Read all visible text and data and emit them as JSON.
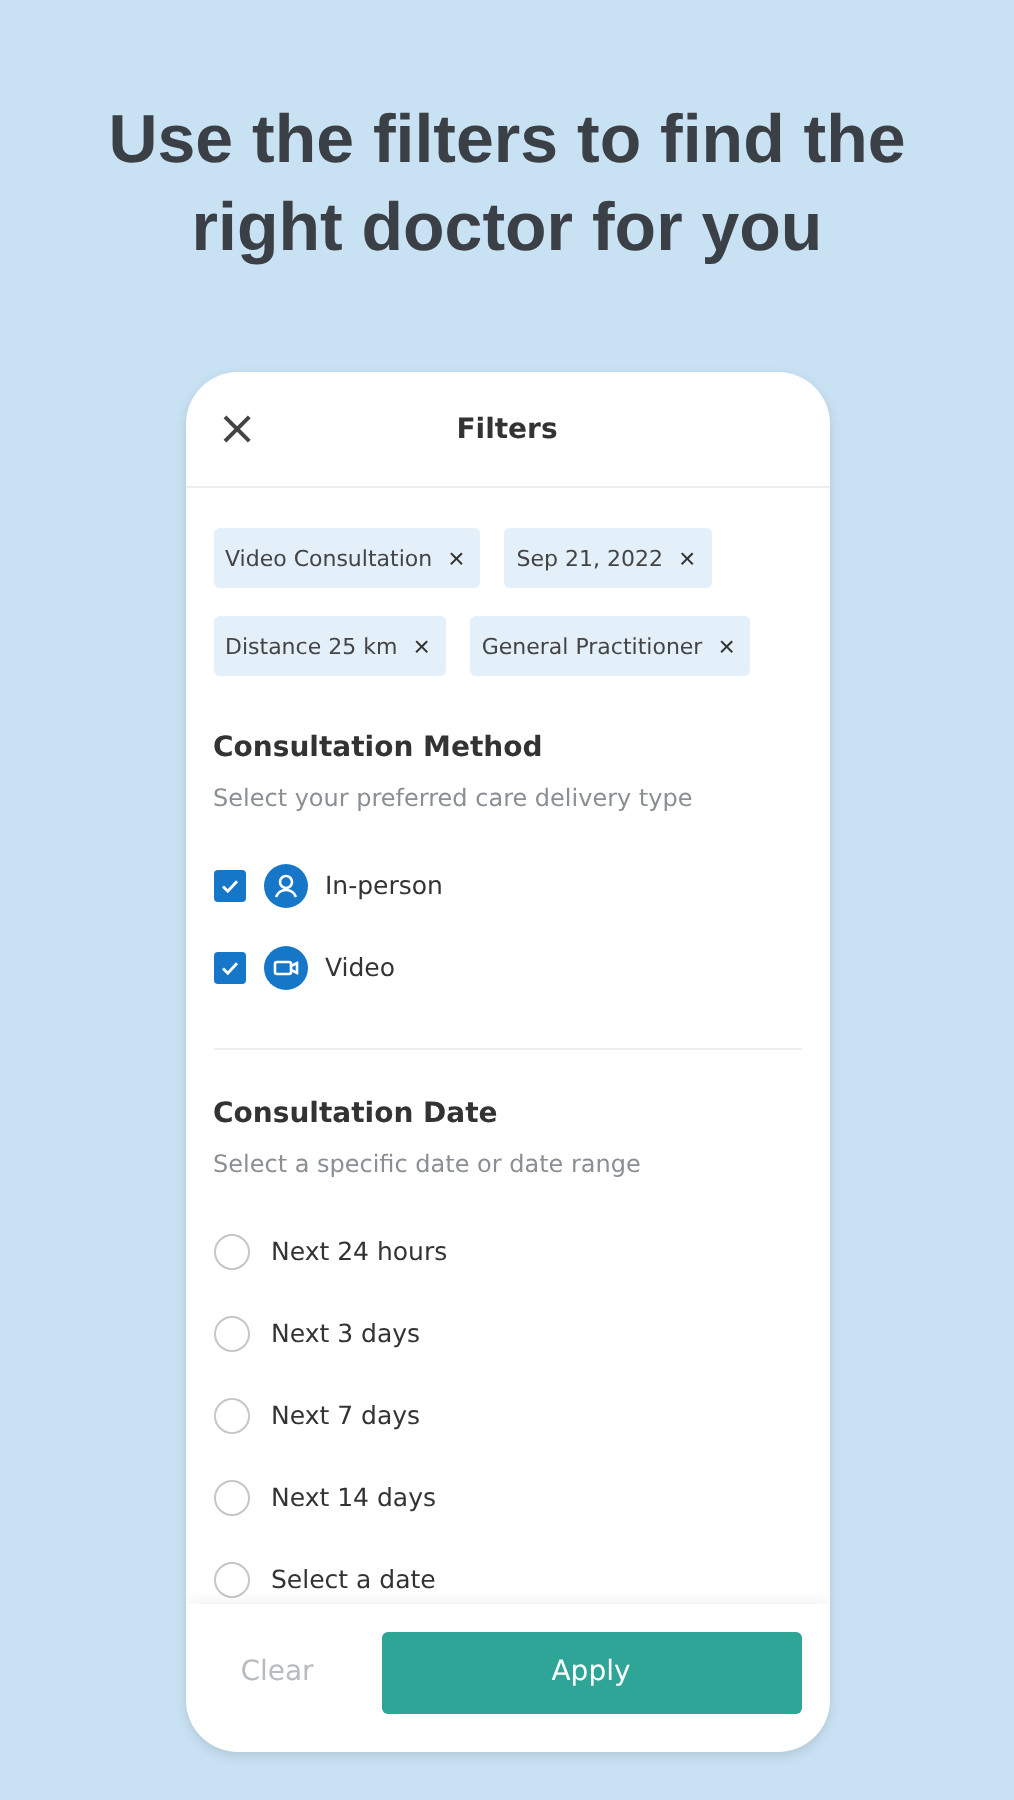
{
  "headline": "Use the filters to find the right doctor for you",
  "header": {
    "close": "×",
    "title": "Filters"
  },
  "chips": [
    {
      "label": "Video Consultation",
      "remove": "×"
    },
    {
      "label": "Sep 21, 2022",
      "remove": "×"
    },
    {
      "label": "Distance 25 km",
      "remove": "×"
    },
    {
      "label": "General Practitioner",
      "remove": "×"
    }
  ],
  "method": {
    "title": "Consultation Method",
    "subtitle": "Select your preferred care delivery type",
    "options": [
      {
        "label": "In-person",
        "kind": "person",
        "checked": true
      },
      {
        "label": "Video",
        "kind": "video",
        "checked": true
      }
    ]
  },
  "date": {
    "title": "Consultation Date",
    "subtitle": "Select a specific date or date range",
    "options": [
      {
        "label": "Next 24 hours",
        "selected": false
      },
      {
        "label": "Next 3 days",
        "selected": false
      },
      {
        "label": "Next 7 days",
        "selected": false
      },
      {
        "label": "Next 14 days",
        "selected": false
      },
      {
        "label": "Select a date",
        "selected": false
      }
    ]
  },
  "footer": {
    "clear": "Clear",
    "apply": "Apply"
  }
}
